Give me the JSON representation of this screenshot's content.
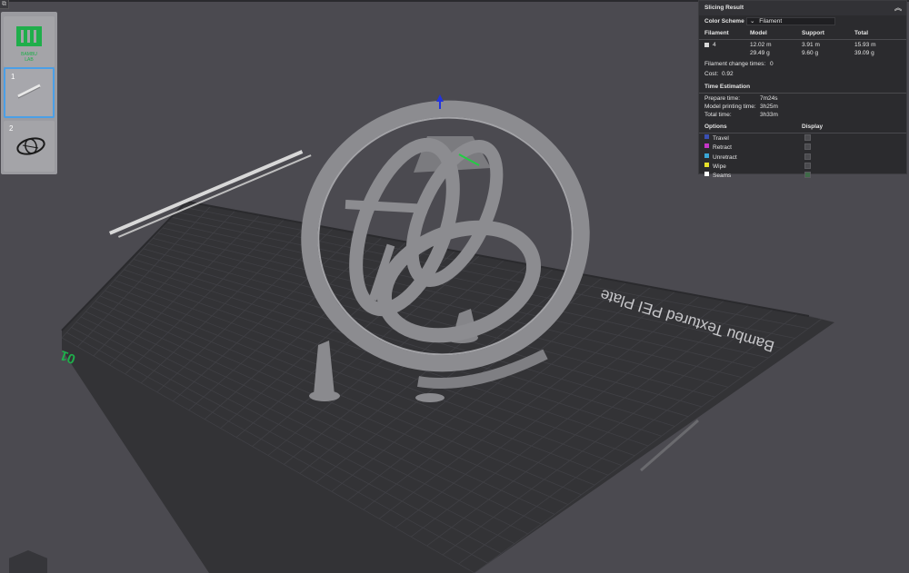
{
  "app": {
    "corner_icon": "⧉"
  },
  "plate_panel": {
    "logo_label": "BAMBU\nLAB",
    "thumbs": [
      {
        "number": "1"
      },
      {
        "number": "2"
      }
    ]
  },
  "scene": {
    "plate_name": "Bambu Textured PEI Plate",
    "plate_number": "01"
  },
  "slicing_result": {
    "title": "Slicing Result",
    "color_scheme_label": "Color Scheme",
    "color_scheme_value": "Filament",
    "headers": {
      "filament": "Filament",
      "model": "Model",
      "support": "Support",
      "total": "Total"
    },
    "filament_row": {
      "id": "4",
      "swatch_color": "#d9d9d9",
      "model_len": "12.02 m",
      "model_weight": "29.49 g",
      "support_len": "3.91 m",
      "support_weight": "9.60 g",
      "total_len": "15.93 m",
      "total_weight": "39.09 g"
    },
    "filament_change_label": "Filament change times:",
    "filament_change_value": "0",
    "cost_label": "Cost:",
    "cost_value": "0.92",
    "time_title": "Time Estimation",
    "prepare_label": "Prepare time:",
    "prepare_value": "7m24s",
    "model_print_label": "Model printing time:",
    "model_print_value": "3h25m",
    "total_label": "Total time:",
    "total_value": "3h33m",
    "options_label": "Options",
    "display_label": "Display",
    "options": [
      {
        "name": "Travel",
        "color": "#3a4fb3",
        "checked": false
      },
      {
        "name": "Retract",
        "color": "#c535c8",
        "checked": false
      },
      {
        "name": "Unretract",
        "color": "#3aa6d6",
        "checked": false
      },
      {
        "name": "Wipe",
        "color": "#e6e02a",
        "checked": false
      },
      {
        "name": "Seams",
        "color": "#ffffff",
        "checked": true
      }
    ]
  },
  "colors": {
    "background": "#4b4a50",
    "bed": "#333336",
    "grid": "#3e3e42",
    "model": "#8c8c90",
    "accent_green": "#1fae4b",
    "selection_blue": "#4b9fe6"
  }
}
